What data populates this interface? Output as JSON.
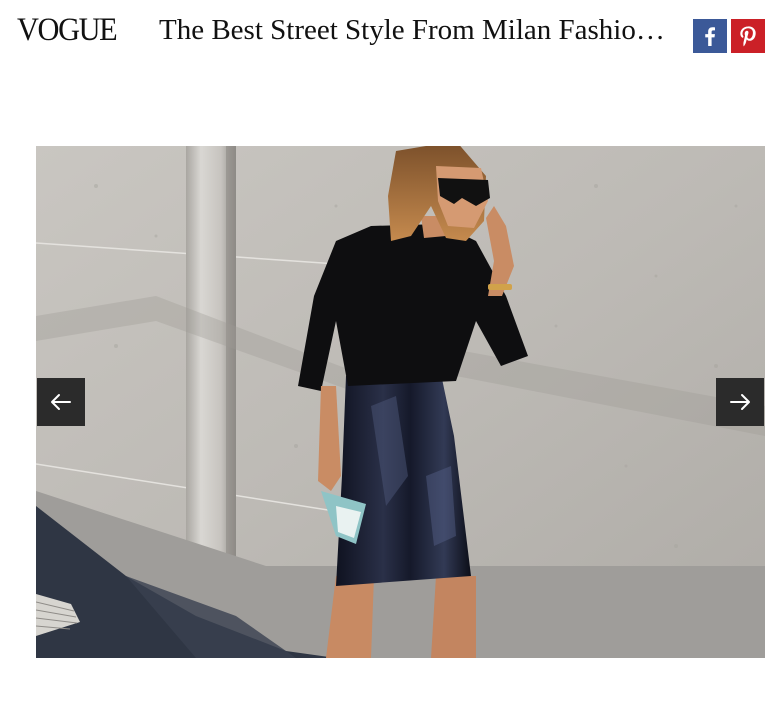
{
  "header": {
    "logo_text": "VOGUE",
    "headline": "The Best Street Style From Milan Fashion Week",
    "share_buttons": [
      {
        "icon": "facebook-icon",
        "color": "#3b5998"
      },
      {
        "icon": "pinterest-icon",
        "color": "#cb2027"
      }
    ]
  },
  "slideshow": {
    "photo_subject": "street-style-photo",
    "prev_icon": "arrow-left-icon",
    "next_icon": "arrow-right-icon",
    "arrow_bg_color": "#2b2b2b"
  }
}
